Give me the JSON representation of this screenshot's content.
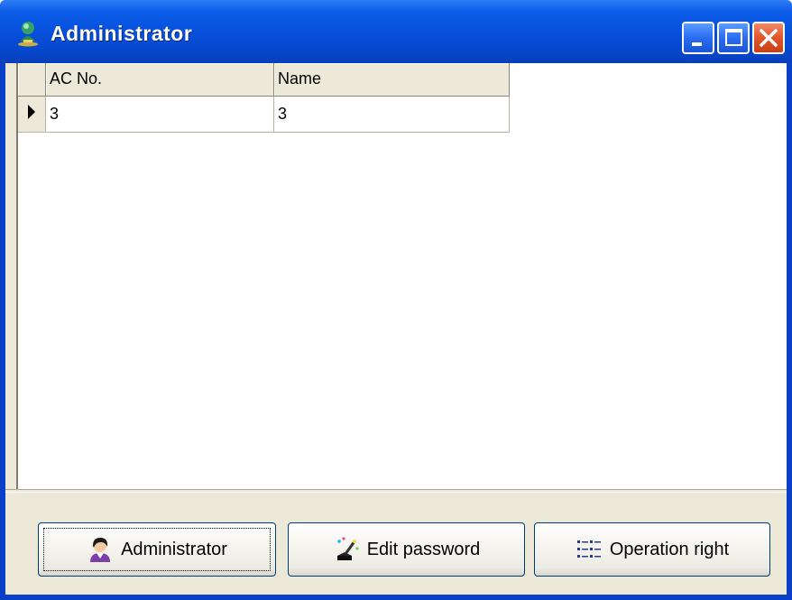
{
  "window": {
    "title": "Administrator",
    "icon": "admin-globe-icon",
    "controls": [
      "minimize-icon",
      "maximize-icon",
      "close-icon"
    ]
  },
  "grid": {
    "columns": [
      "AC No.",
      "Name"
    ],
    "rows": [
      {
        "indicator": "current-row-arrow-icon",
        "ac_no": "3",
        "name": "3"
      }
    ]
  },
  "buttons": {
    "administrator": {
      "label": "Administrator",
      "icon": "administrator-person-icon"
    },
    "edit_password": {
      "label": "Edit password",
      "icon": "edit-password-wand-icon"
    },
    "operation_right": {
      "label": "Operation right",
      "icon": "operation-right-list-icon"
    }
  },
  "colors": {
    "titlebar": "#0750dc",
    "close_button": "#e2542a",
    "client_bg": "#ece9d8",
    "button_border": "#003c74"
  }
}
